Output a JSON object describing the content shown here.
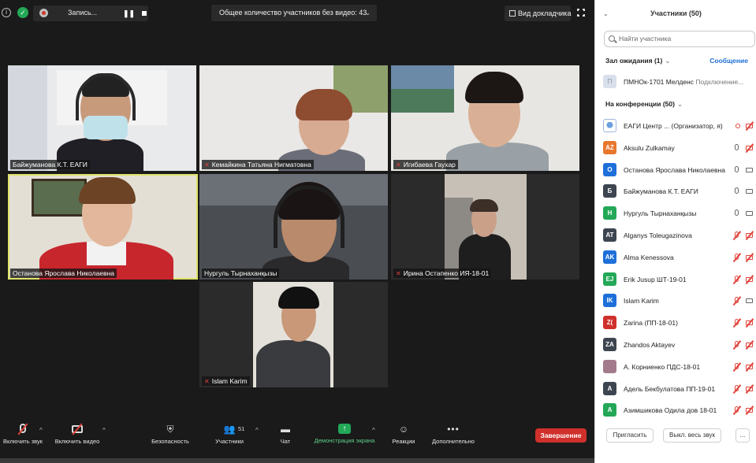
{
  "topbar": {
    "recording_label": "Запись...",
    "participants_count_label": "Общее количество участников без видео: 43",
    "view_label": "Вид докладчика"
  },
  "tiles": [
    {
      "name": "Байжуманова К.Т. ЕАГИ",
      "muted": false
    },
    {
      "name": "Кемайкина Татьяна Нигматовна",
      "muted": true
    },
    {
      "name": "Игибаева Гаухар",
      "muted": true
    },
    {
      "name": "Останова Ярослава Николаевна",
      "muted": false
    },
    {
      "name": "Нургуль Тырнаханқызы",
      "muted": false
    },
    {
      "name": "Ирина Остапенко ИЯ-18-01",
      "muted": true
    },
    {
      "name": "Islam Karim",
      "muted": true
    }
  ],
  "toolbar": {
    "audio_label": "Включить звук",
    "video_label": "Включить видео",
    "security_label": "Безопасность",
    "participants_label": "Участники",
    "participants_count": "51",
    "chat_label": "Чат",
    "share_label": "Демонстрация экрана",
    "reactions_label": "Реакции",
    "more_label": "Дополнительно",
    "end_label": "Завершение"
  },
  "panel": {
    "title": "Участники (50)",
    "search_placeholder": "Найти участника",
    "waiting_room_label": "Зал ожидания (1)",
    "message_label": "Сообщение",
    "waiting_participant": {
      "initial": "П",
      "name": "ПМНОк-1701 Мелденс",
      "status": "Подключение..."
    },
    "in_meeting_label": "На конференции (50)",
    "invite_label": "Пригласить",
    "mute_all_label": "Выкл. весь звук",
    "more_label": "...",
    "participants": [
      {
        "initials": "",
        "name": "ЕАГИ Центр ... (Организатор, я)",
        "color": "#ffffff",
        "mic": "rec",
        "cam": "off"
      },
      {
        "initials": "AZ",
        "name": "Aksulu Zulkamay",
        "color": "#e8772e",
        "mic": "on",
        "cam": "off"
      },
      {
        "initials": "О",
        "name": "Останова Ярослава Николаевна",
        "color": "#1e6fd9",
        "mic": "on",
        "cam": "on"
      },
      {
        "initials": "Б",
        "name": "Байжуманова К.Т. ЕАГИ",
        "color": "#3d4550",
        "mic": "on",
        "cam": "on"
      },
      {
        "initials": "Н",
        "name": "Нургуль Тырнаханқызы",
        "color": "#23a857",
        "mic": "on",
        "cam": "on"
      },
      {
        "initials": "AT",
        "name": "Alganys Toleugazinova",
        "color": "#3d4550",
        "mic": "off",
        "cam": "off"
      },
      {
        "initials": "AK",
        "name": "Alma Kenessova",
        "color": "#1e6fd9",
        "mic": "off",
        "cam": "off"
      },
      {
        "initials": "EJ",
        "name": "Erik Jusup ШТ-19-01",
        "color": "#23a857",
        "mic": "off",
        "cam": "off"
      },
      {
        "initials": "IK",
        "name": "Islam Karim",
        "color": "#1e6fd9",
        "mic": "off",
        "cam": "on"
      },
      {
        "initials": "Z(",
        "name": "Zarina (ПП-18-01)",
        "color": "#d0302b",
        "mic": "off",
        "cam": "off"
      },
      {
        "initials": "ZA",
        "name": "Zhandos Aktayev",
        "color": "#3d4550",
        "mic": "off",
        "cam": "off"
      },
      {
        "initials": "",
        "name": "А. Корниенко ПДС-18-01",
        "color": "#a37a8c",
        "mic": "off",
        "cam": "off"
      },
      {
        "initials": "А",
        "name": "Адель Бекбулатова ПП-19-01",
        "color": "#3d4550",
        "mic": "off",
        "cam": "off"
      },
      {
        "initials": "А",
        "name": "Азимшикова Одила дов 18-01",
        "color": "#23a857",
        "mic": "off",
        "cam": "off"
      }
    ]
  }
}
